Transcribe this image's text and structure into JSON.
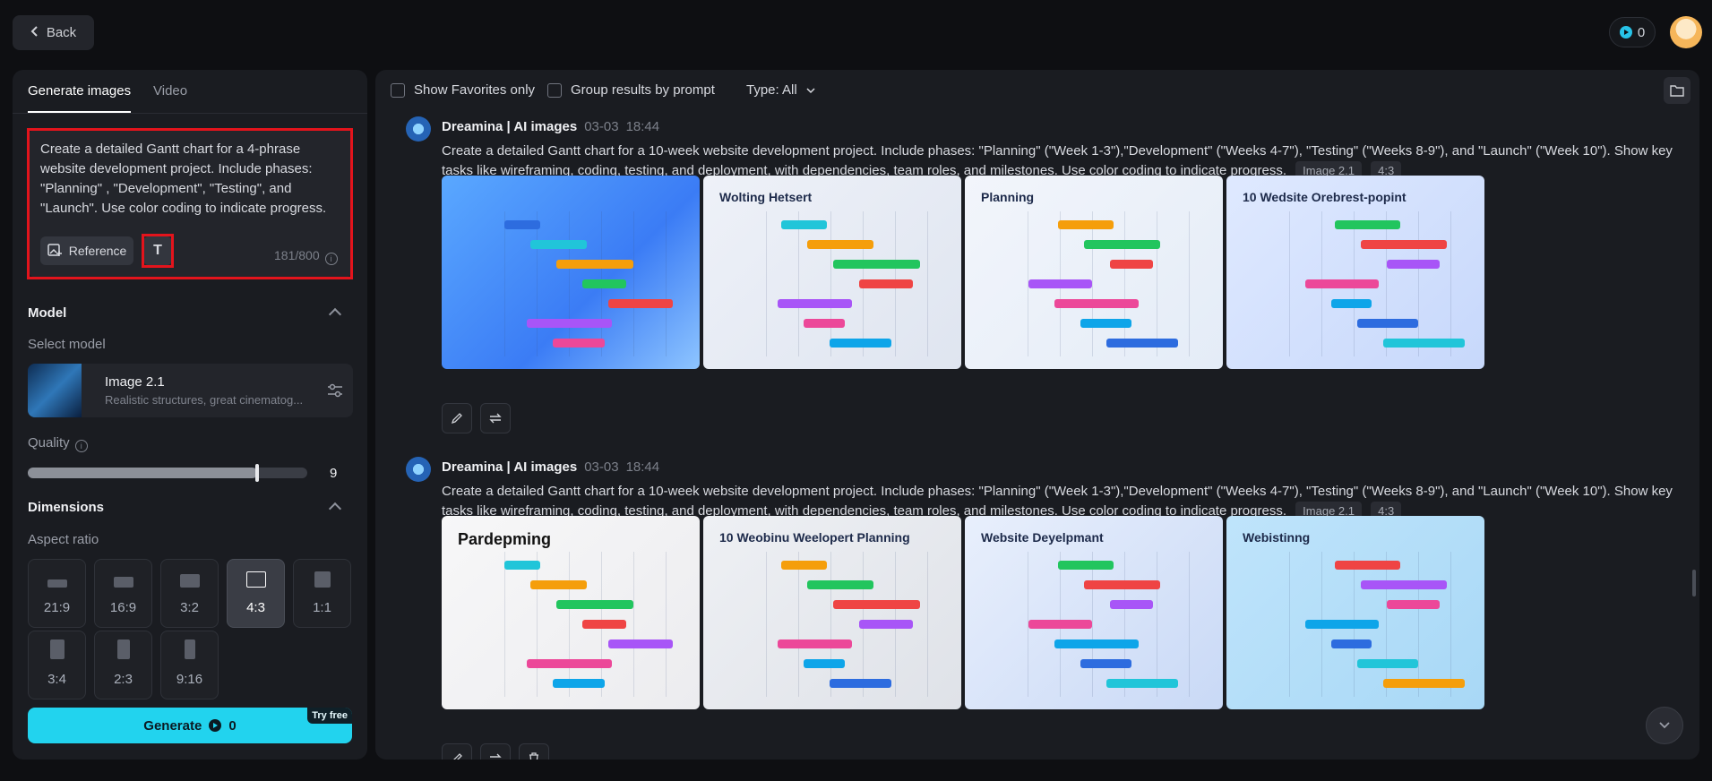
{
  "topbar": {
    "back_label": "Back",
    "credits": "0"
  },
  "left": {
    "tabs": [
      "Generate images",
      "Video"
    ],
    "prompt": "Create a detailed Gantt chart for a 4-phrase website development project. Include phases: \"Planning\" , \"Development\", \"Testing\", and \"Launch\". Use color coding to indicate progress.",
    "reference_label": "Reference",
    "text_tool_glyph": "T",
    "char_count": "181/800",
    "model_section": "Model",
    "select_model_label": "Select model",
    "model_name": "Image 2.1",
    "model_desc": "Realistic structures, great cinematog...",
    "quality_label": "Quality",
    "quality_value": "9",
    "quality_fraction": 0.82,
    "dimensions_section": "Dimensions",
    "aspect_ratio_label": "Aspect ratio",
    "ratios": [
      "21:9",
      "16:9",
      "3:2",
      "4:3",
      "1:1",
      "3:4",
      "2:3",
      "9:16"
    ],
    "selected_ratio": "4:3",
    "generate_label": "Generate",
    "generate_cost": "0",
    "try_free": "Try free"
  },
  "main": {
    "show_favorites": "Show Favorites only",
    "group_by_prompt": "Group results by prompt",
    "type_filter": "Type: All",
    "groups": [
      {
        "source": "Dreamina | AI images",
        "date": "03-03",
        "time": "18:44",
        "prompt": "Create a detailed Gantt chart for a 10-week website development project. Include phases: \"Planning\" (\"Week 1-3\"),\"Development\" (\"Weeks 4-7\"), \"Testing\" (\"Weeks 8-9\"), and \"Launch\" (\"Week 10\"). Show key tasks like wireframing, coding, testing, and deployment, with dependencies, team roles, and milestones. Use color coding to indicate progress.",
        "model_tag": "Image 2.1",
        "ratio_tag": "4:3",
        "thumb_titles": [
          "",
          "Wolting Hetsert",
          "Planning",
          "10 Wedsite Orebrest-popint"
        ]
      },
      {
        "source": "Dreamina | AI images",
        "date": "03-03",
        "time": "18:44",
        "prompt": "Create a detailed Gantt chart for a 10-week website development project. Include phases: \"Planning\" (\"Week 1-3\"),\"Development\" (\"Weeks 4-7\"), \"Testing\" (\"Weeks 8-9\"), and \"Launch\" (\"Week 10\"). Show key tasks like wireframing, coding, testing, and deployment, with dependencies, team roles, and milestones. Use color coding to indicate progress.",
        "model_tag": "Image 2.1",
        "ratio_tag": "4:3",
        "thumb_titles": [
          "Pardepming",
          "10 Weobinu Weelopert Planning",
          "Website Deyelpmant",
          "Webistinng"
        ]
      }
    ]
  },
  "colors": {
    "accent": "#22d3ee",
    "highlight": "#e3141c"
  }
}
